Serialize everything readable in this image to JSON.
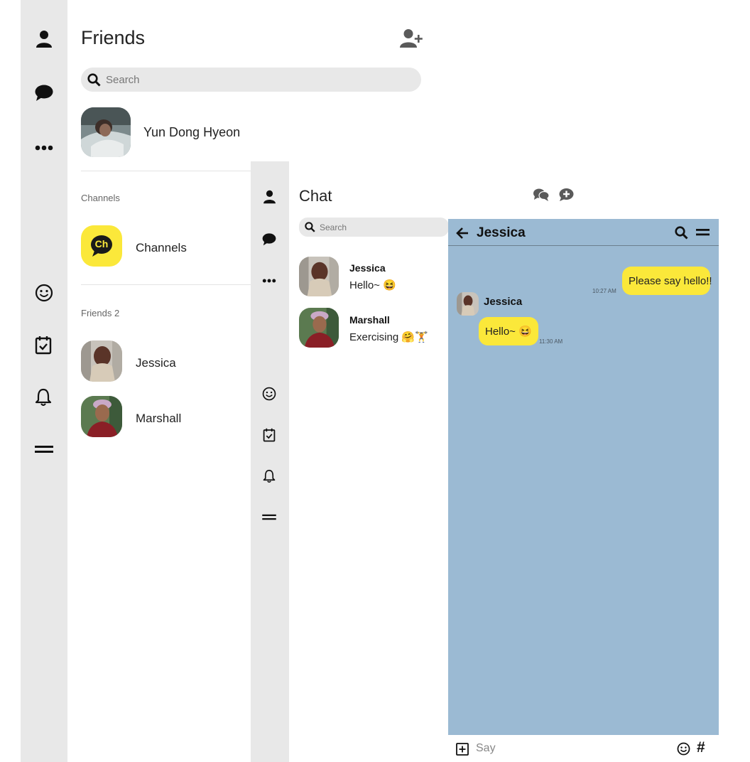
{
  "friends_screen": {
    "title": "Friends",
    "search_placeholder": "Search",
    "profile_name": "Yun Dong Hyeon",
    "channels_section_label": "Channels",
    "channel_item_label": "Channels",
    "channel_logo_text": "Ch",
    "friends_section_label": "Friends 2",
    "friends": [
      {
        "name": "Jessica"
      },
      {
        "name": "Marshall"
      }
    ]
  },
  "chat_screen": {
    "title": "Chat",
    "search_placeholder": "Search",
    "chats": [
      {
        "name": "Jessica",
        "last_message": "Hello~ 😆"
      },
      {
        "name": "Marshall",
        "last_message": "Exercising 🤗🏋"
      }
    ]
  },
  "conversation": {
    "title": "Jessica",
    "messages": [
      {
        "from": "me",
        "text": "Please say hello!!",
        "time": "10:27 AM"
      },
      {
        "from": "Jessica",
        "sender_name": "Jessica",
        "text": "Hello~ 😆",
        "time": "11:30 AM"
      }
    ],
    "input_placeholder": "Say",
    "input_hash": "#"
  },
  "colors": {
    "sidebar_bg": "#e8e8e8",
    "accent_yellow": "#fbe83a",
    "chat_room_bg": "#9bbad3"
  },
  "icons": [
    "person-icon",
    "chat-bubble-icon",
    "more-dots-icon",
    "smiley-icon",
    "calendar-check-icon",
    "bell-icon",
    "menu-icon",
    "add-friend-icon",
    "search-icon",
    "chats-icon",
    "new-chat-icon",
    "back-arrow-icon",
    "plus-square-icon",
    "emoji-icon",
    "hash-icon"
  ]
}
